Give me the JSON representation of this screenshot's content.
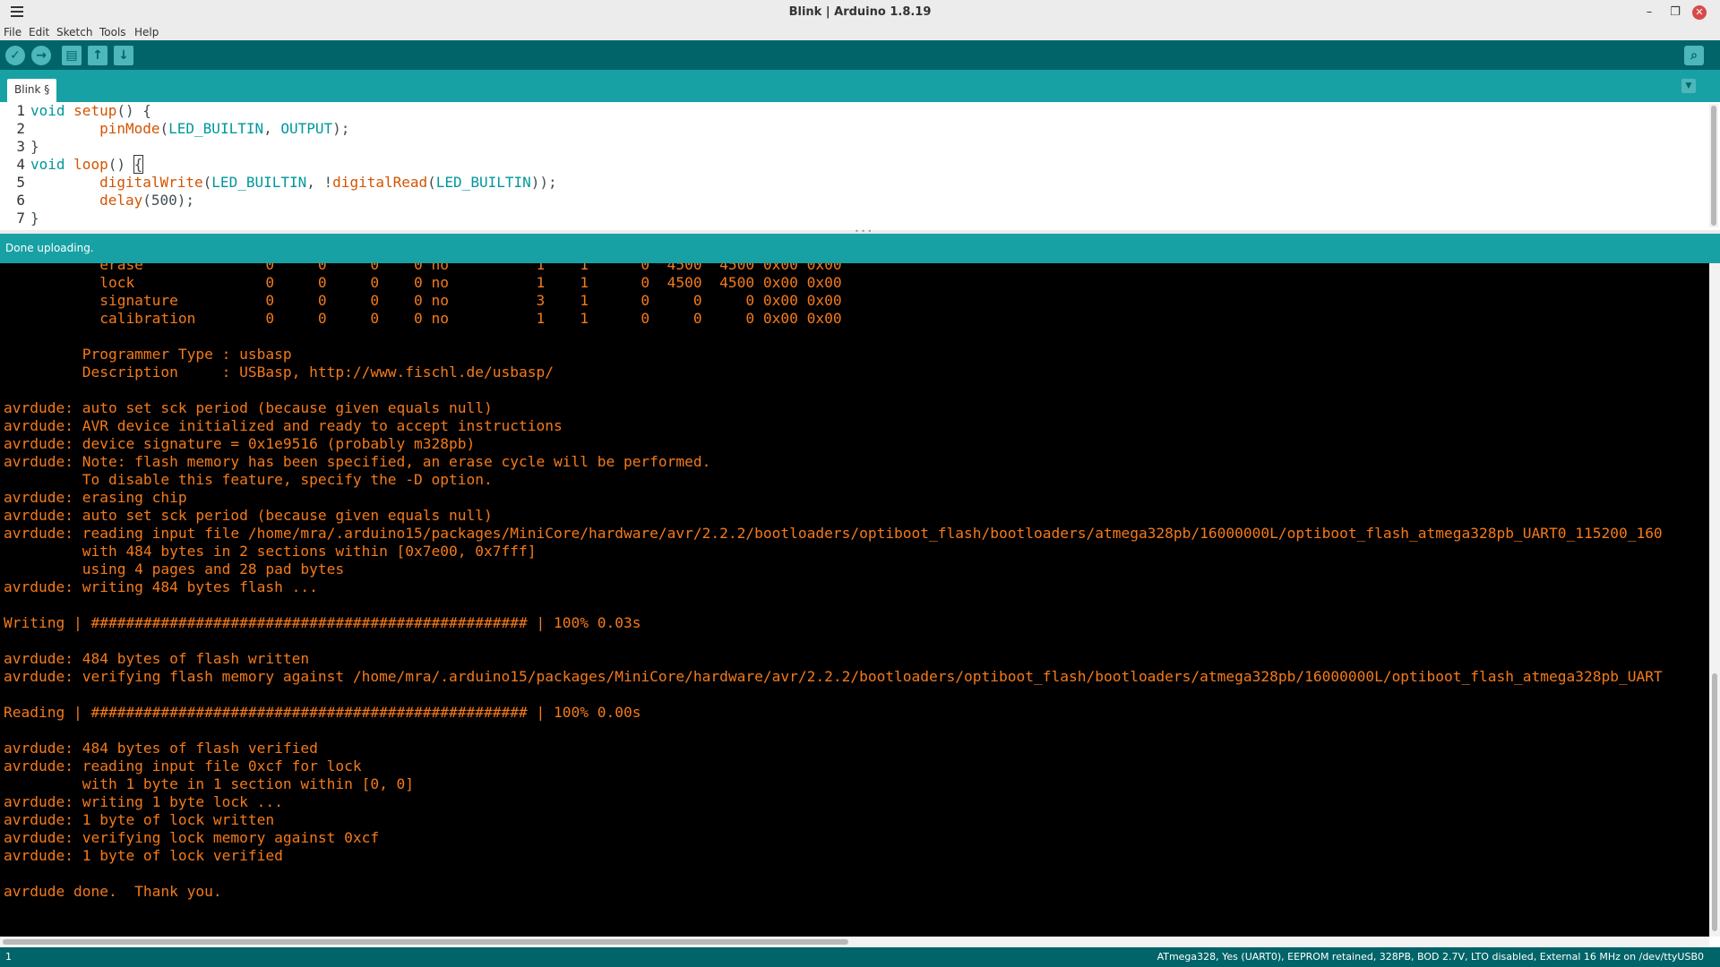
{
  "window": {
    "title": "Blink | Arduino 1.8.19",
    "minimize_glyph": "–",
    "maximize_glyph": "❐",
    "close_glyph": "✕"
  },
  "menu": [
    "File",
    "Edit",
    "Sketch",
    "Tools",
    "Help"
  ],
  "toolbar": {
    "verify_glyph": "✓",
    "upload_glyph": "→",
    "new_glyph": "▤",
    "open_glyph": "↑",
    "save_glyph": "↓",
    "serial_glyph": "⌕"
  },
  "tabs": [
    {
      "label": "Blink §",
      "active": true
    }
  ],
  "tab_menu_glyph": "▼",
  "editor": {
    "line_numbers": [
      "1",
      "2",
      "3",
      "4",
      "5",
      "6",
      "7"
    ],
    "l1": {
      "kw": "void",
      "fn": "setup",
      "rest": "() {"
    },
    "l2": {
      "indent": "        ",
      "fn": "pinMode",
      "open": "(",
      "c1": "LED_BUILTIN",
      "sep": ", ",
      "c2": "OUTPUT",
      "close": ");"
    },
    "l3": "}",
    "l4": {
      "kw": "void",
      "fn": "loop",
      "rest": "() ",
      "brace": "{"
    },
    "l5": {
      "indent": "        ",
      "fn": "digitalWrite",
      "open": "(",
      "c1": "LED_BUILTIN",
      "sep": ", !",
      "fn2": "digitalRead",
      "open2": "(",
      "c2": "LED_BUILTIN",
      "close": "));"
    },
    "l6": {
      "indent": "        ",
      "fn": "delay",
      "rest": "(500);"
    },
    "l7": "}"
  },
  "status": {
    "message": "Done uploading."
  },
  "console_text": "           erase              0     0     0    0 no          1    1      0  4500  4500 0x00 0x00\n           lock               0     0     0    0 no          1    1      0  4500  4500 0x00 0x00\n           signature          0     0     0    0 no          3    1      0     0     0 0x00 0x00\n           calibration        0     0     0    0 no          1    1      0     0     0 0x00 0x00\n\n         Programmer Type : usbasp\n         Description     : USBasp, http://www.fischl.de/usbasp/\n\navrdude: auto set sck period (because given equals null)\navrdude: AVR device initialized and ready to accept instructions\navrdude: device signature = 0x1e9516 (probably m328pb)\navrdude: Note: flash memory has been specified, an erase cycle will be performed.\n         To disable this feature, specify the -D option.\navrdude: erasing chip\navrdude: auto set sck period (because given equals null)\navrdude: reading input file /home/mra/.arduino15/packages/MiniCore/hardware/avr/2.2.2/bootloaders/optiboot_flash/bootloaders/atmega328pb/16000000L/optiboot_flash_atmega328pb_UART0_115200_160\n         with 484 bytes in 2 sections within [0x7e00, 0x7fff]\n         using 4 pages and 28 pad bytes\navrdude: writing 484 bytes flash ...\n\nWriting | ################################################## | 100% 0.03s\n\navrdude: 484 bytes of flash written\navrdude: verifying flash memory against /home/mra/.arduino15/packages/MiniCore/hardware/avr/2.2.2/bootloaders/optiboot_flash/bootloaders/atmega328pb/16000000L/optiboot_flash_atmega328pb_UART\n\nReading | ################################################## | 100% 0.00s\n\navrdude: 484 bytes of flash verified\navrdude: reading input file 0xcf for lock\n         with 1 byte in 1 section within [0, 0]\navrdude: writing 1 byte lock ...\navrdude: 1 byte of lock written\navrdude: verifying lock memory against 0xcf\navrdude: 1 byte of lock verified\n\navrdude done.  Thank you.",
  "bottom": {
    "line_number": "1",
    "board_info": "ATmega328, Yes (UART0), EEPROM retained, 328PB, BOD 2.7V, LTO disabled, External 16 MHz on /dev/ttyUSB0"
  },
  "colors": {
    "toolbar": "#006468",
    "tabbar": "#17a1a5",
    "console_text": "#f47a1b",
    "keyword": "#00979c",
    "function": "#d35400"
  }
}
